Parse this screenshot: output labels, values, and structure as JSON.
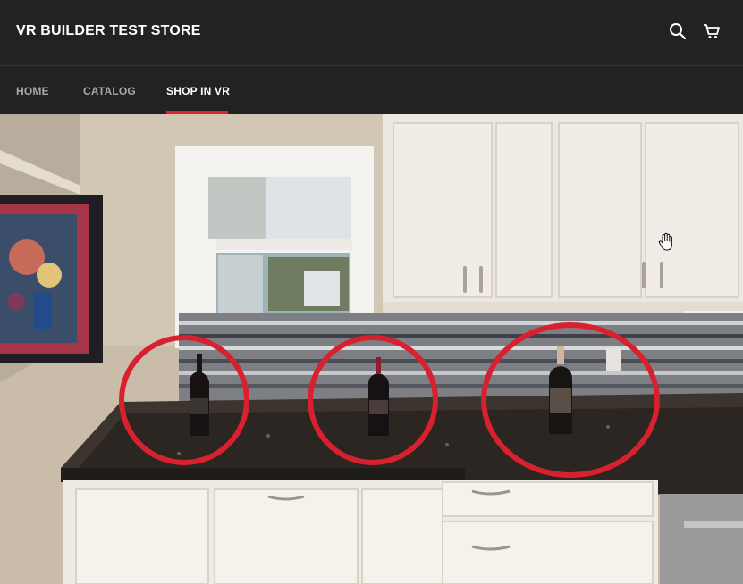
{
  "store": {
    "title": "VR BUILDER TEST STORE"
  },
  "header": {
    "icons": [
      "search-icon",
      "cart-icon"
    ]
  },
  "nav": {
    "items": [
      {
        "label": "HOME",
        "active": false
      },
      {
        "label": "CATALOG",
        "active": false
      },
      {
        "label": "SHOP IN VR",
        "active": true
      }
    ]
  },
  "colors": {
    "header_bg": "#222222",
    "accent": "#e02234",
    "nav_text": "#a9a9a9",
    "active_text": "#ffffff"
  },
  "vr_scene": {
    "hotspots": [
      "wine-bottle-1",
      "wine-bottle-2",
      "wine-bottle-3"
    ]
  }
}
